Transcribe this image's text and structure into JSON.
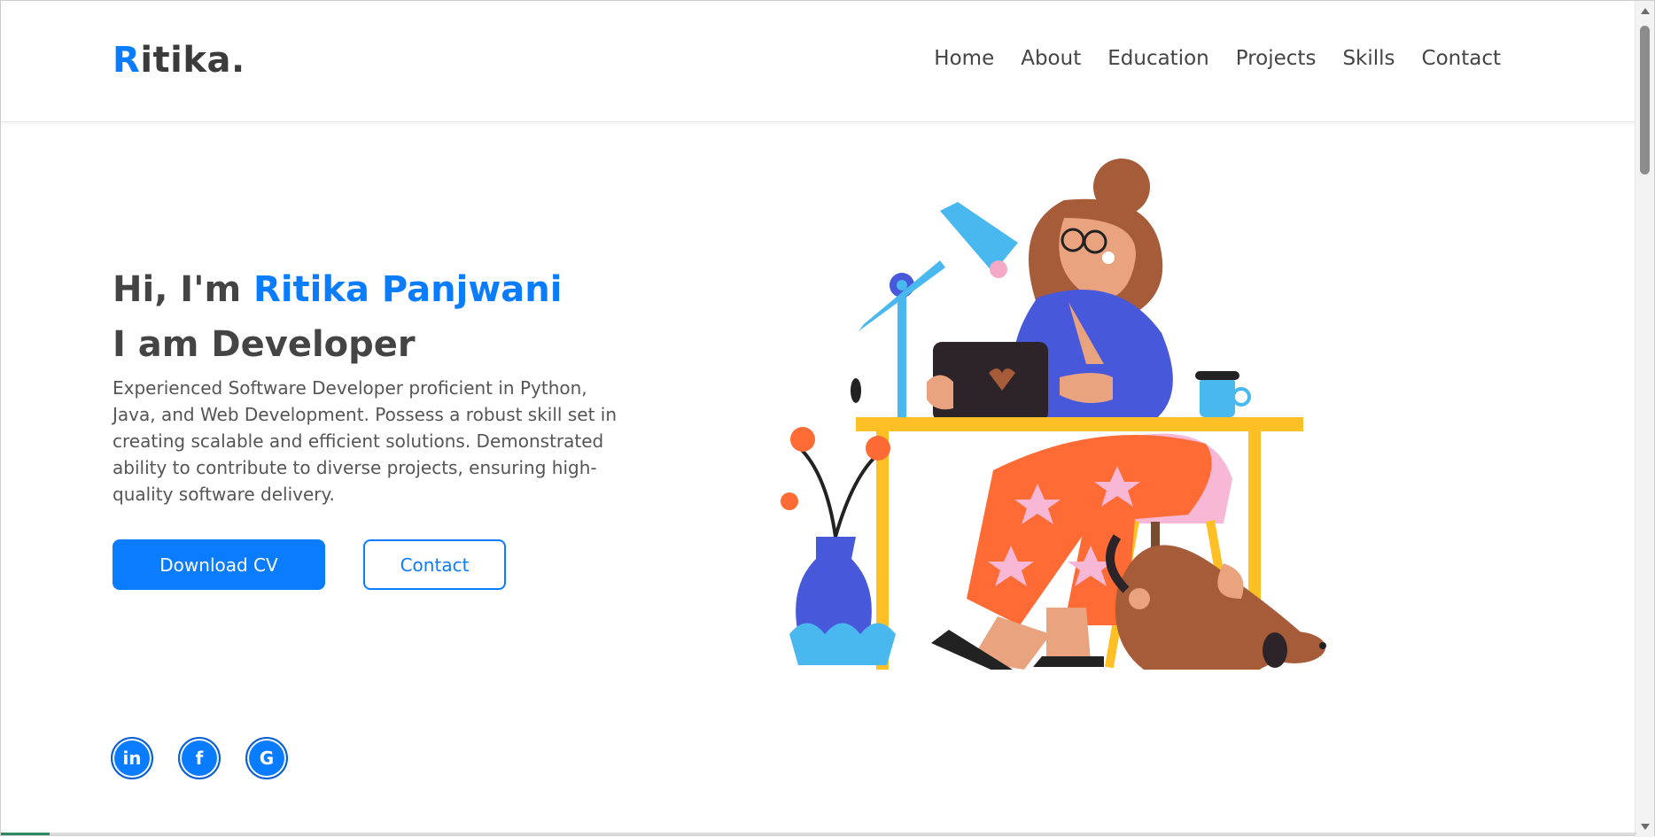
{
  "brand": {
    "logo_first": "R",
    "logo_rest": "itika.",
    "accent_color": "#0a7cff"
  },
  "nav": {
    "items": [
      "Home",
      "About",
      "Education",
      "Projects",
      "Skills",
      "Contact"
    ]
  },
  "hero": {
    "greeting": "Hi, I'm ",
    "name": "Ritika Panjwani",
    "role_line": "I am Developer",
    "description": "Experienced Software Developer proficient in Python, Java, and Web Development. Possess a robust skill set in creating scalable and efficient solutions. Demonstrated ability to contribute to diverse projects, ensuring high-quality software delivery.",
    "primary_button": "Download CV",
    "secondary_button": "Contact"
  },
  "socials": {
    "linkedin_glyph": "in",
    "facebook_glyph": "f",
    "google_glyph": "G",
    "items": [
      "linkedin-icon",
      "facebook-icon",
      "google-icon"
    ]
  }
}
